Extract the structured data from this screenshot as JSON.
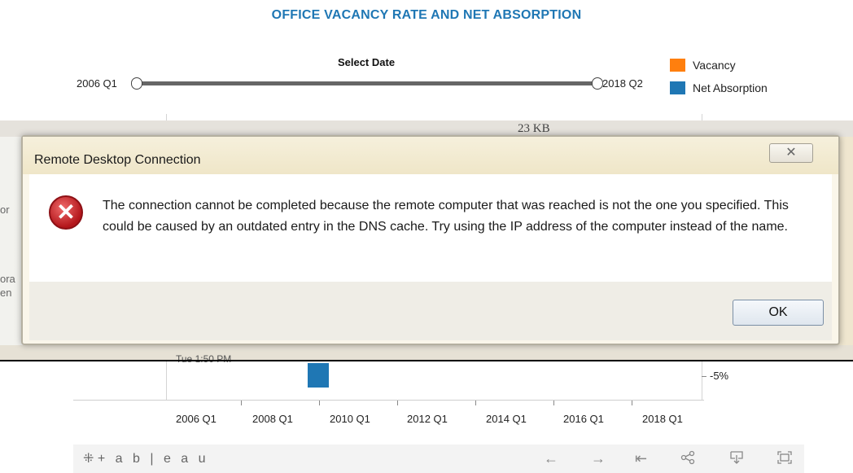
{
  "chart": {
    "title": "OFFICE VACANCY RATE AND NET ABSORPTION",
    "slider": {
      "label": "Select Date",
      "start": "2006 Q1",
      "end": "2018 Q2"
    },
    "legend": [
      {
        "label": "Vacancy",
        "color": "#ff7f0e"
      },
      {
        "label": "Net Absorption",
        "color": "#1f77b4"
      }
    ],
    "x_ticks": [
      "2006 Q1",
      "2008 Q1",
      "2010 Q1",
      "2012 Q1",
      "2014 Q1",
      "2016 Q1",
      "2018 Q1"
    ],
    "y_right_tick": "-5%"
  },
  "background_window": {
    "file_size": "23 KB",
    "partial_left_texts": [
      "or",
      "ora",
      "en"
    ],
    "partial_bottom_text": "Tue 1:50 PM"
  },
  "dialog": {
    "title": "Remote Desktop Connection",
    "close_glyph": "✕",
    "icon": "error-icon",
    "message": "The connection cannot be completed because the remote computer that was reached is not the one you specified. This could be caused by an outdated entry in the DNS cache. Try using the IP address of the computer instead of the name.",
    "ok_label": "OK"
  },
  "footer": {
    "logo_text": "+ a b | e a u",
    "icons": [
      "undo-icon",
      "redo-icon",
      "revert-icon",
      "share-icon",
      "download-icon",
      "fullscreen-icon"
    ]
  }
}
